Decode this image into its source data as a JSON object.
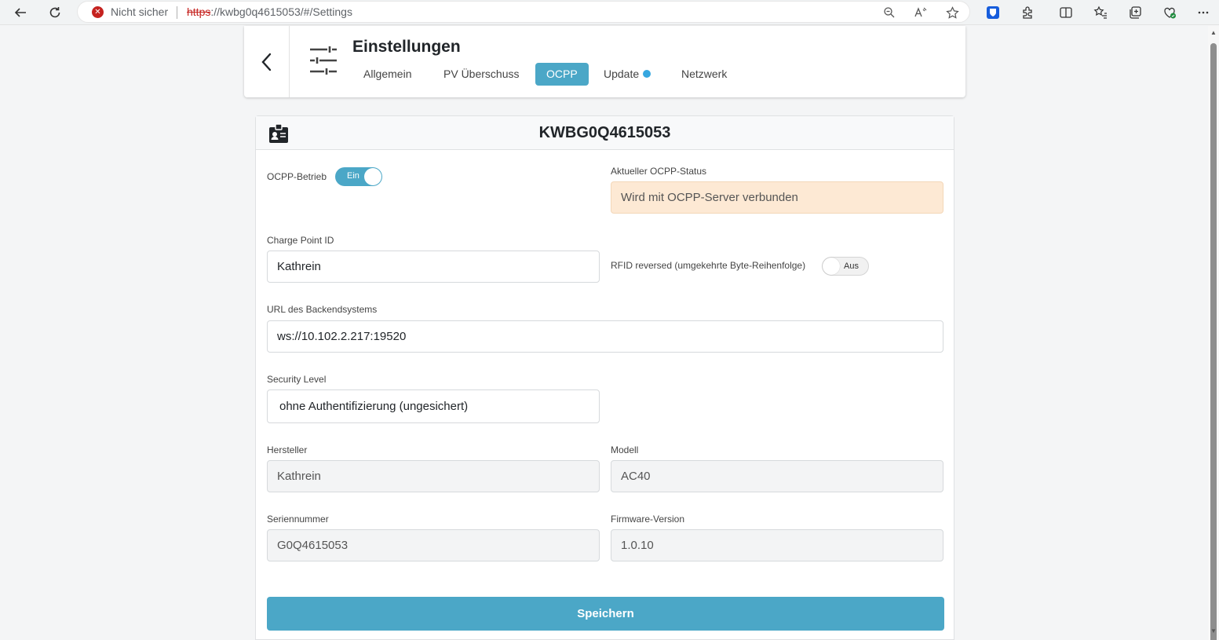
{
  "browser": {
    "security_text": "Nicht sicher",
    "url_scheme": "https",
    "url_rest": "://kwbg0q4615053/#/Settings"
  },
  "header": {
    "title": "Einstellungen",
    "tabs": [
      {
        "label": "Allgemein"
      },
      {
        "label": "PV Überschuss"
      },
      {
        "label": "OCPP"
      },
      {
        "label": "Update"
      },
      {
        "label": "Netzwerk"
      }
    ],
    "active_tab": "OCPP"
  },
  "card": {
    "title": "KWBG0Q4615053"
  },
  "form": {
    "ocpp_betrieb": {
      "label": "OCPP-Betrieb",
      "toggle_label": "Ein"
    },
    "ocpp_status": {
      "label": "Aktueller OCPP-Status",
      "value": "Wird mit OCPP-Server verbunden"
    },
    "charge_point_id": {
      "label": "Charge Point ID",
      "value": "Kathrein"
    },
    "rfid_reversed": {
      "label": "RFID reversed (umgekehrte Byte-Reihenfolge)",
      "toggle_label": "Aus"
    },
    "backend_url": {
      "label": "URL des Backendsystems",
      "value": "ws://10.102.2.217:19520"
    },
    "security_level": {
      "label": "Security Level",
      "value": "ohne Authentifizierung (ungesichert)"
    },
    "hersteller": {
      "label": "Hersteller",
      "value": "Kathrein"
    },
    "modell": {
      "label": "Modell",
      "value": "AC40"
    },
    "seriennummer": {
      "label": "Seriennummer",
      "value": "G0Q4615053"
    },
    "firmware": {
      "label": "Firmware-Version",
      "value": "1.0.10"
    },
    "save_label": "Speichern"
  },
  "colors": {
    "accent": "#4ba7c7",
    "status_bg": "#fde9d4",
    "update_dot": "#36a7e0"
  }
}
